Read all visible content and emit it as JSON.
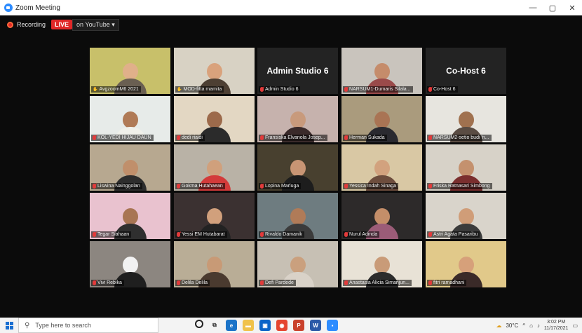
{
  "window": {
    "title": "Zoom Meeting",
    "minimize": "—",
    "maximize": "▢",
    "close": "✕"
  },
  "recording": {
    "label": "Recording",
    "live": "LIVE",
    "destination": "on YouTube ▾"
  },
  "tiles": [
    {
      "name": "AvgzoomM6 2021",
      "muted": false,
      "bg": "#c8c06a",
      "skin": "#e0b08a",
      "shirt": "#6a5f52"
    },
    {
      "name": "MOD-fitta mamita",
      "muted": false,
      "bg": "#d8d2c4",
      "skin": "#d9a27c",
      "shirt": "#4d3f33"
    },
    {
      "name": "Admin Studio 6",
      "muted": true,
      "title": "Admin Studio 6"
    },
    {
      "name": "NARSUM1-Dumaris Silala...",
      "muted": true,
      "bg": "#c9c4bd",
      "skin": "#c58c6b",
      "shirt": "#9a4a4a"
    },
    {
      "name": "Co-Host 6",
      "muted": true,
      "title": "Co-Host 6"
    },
    {
      "name": "KOL-YEDI HIJAU DAUN",
      "muted": true,
      "bg": "#e7ebe9",
      "skin": "#b07a56",
      "shirt": "#f0f0ea"
    },
    {
      "name": "dedi riaidi",
      "muted": true,
      "bg": "#e3d7c3",
      "skin": "#9c6a4b",
      "shirt": "#2b2b2b"
    },
    {
      "name": "Fransiska Elvanola Josep...",
      "muted": true,
      "bg": "#c6b2ad",
      "skin": "#c89a7c",
      "shirt": "#3a2a2a"
    },
    {
      "name": "Herman Sukada",
      "muted": true,
      "bg": "#aa9b7d",
      "skin": "#a97454",
      "shirt": "#2a2a30"
    },
    {
      "name": "NARSUM2-setio budi 'n...",
      "muted": true,
      "bg": "#e7e5df",
      "skin": "#a0714f",
      "shirt": "#5a4c43"
    },
    {
      "name": "Liswina Nainggolan",
      "muted": true,
      "bg": "#b7a890",
      "skin": "#c08f6b",
      "shirt": "#2d2d2d"
    },
    {
      "name": "Gokma Hutahaean",
      "muted": true,
      "bg": "#b9b2a6",
      "skin": "#d0a07c",
      "shirt": "#d33a3a"
    },
    {
      "name": "Lopina Marluga",
      "muted": true,
      "bg": "#48402f",
      "skin": "#c89574",
      "shirt": "#1d1d1d"
    },
    {
      "name": "Yessica Indah Sinaga",
      "muted": true,
      "bg": "#d9c8a4",
      "skin": "#d2a27e",
      "shirt": "#6d4d3d"
    },
    {
      "name": "Friska Ratnasari Simbong",
      "muted": true,
      "bg": "#d7d2c8",
      "skin": "#c4916e",
      "shirt": "#7a2e2e"
    },
    {
      "name": "Tegar Siahaan",
      "muted": true,
      "bg": "#e9c2cf",
      "skin": "#a87553",
      "shirt": "#2f2f2f"
    },
    {
      "name": "Yessi EM Hutabarat",
      "muted": true,
      "bg": "#3b3131",
      "skin": "#d1a07c",
      "shirt": "#222222"
    },
    {
      "name": "Rivaldo Damanik",
      "muted": true,
      "bg": "#6e7c80",
      "skin": "#b07b58",
      "shirt": "#3b3b3b"
    },
    {
      "name": "Nurul Adinda",
      "muted": true,
      "bg": "#2d2a2a",
      "skin": "#c48e69",
      "shirt": "#9b5c78"
    },
    {
      "name": "Astri Agata Pasaribu",
      "muted": true,
      "bg": "#d9d4cb",
      "skin": "#d09d78",
      "shirt": "#3b3b3b"
    },
    {
      "name": "Vivi Rebika",
      "muted": true,
      "bg": "#8c8680",
      "skin": "#f2f2f2",
      "shirt": "#1f1f1f"
    },
    {
      "name": "Delila Delila",
      "muted": true,
      "bg": "#b9ad96",
      "skin": "#c89a76",
      "shirt": "#4a3a2f"
    },
    {
      "name": "Defi Pardede",
      "muted": true,
      "bg": "#c7c0b4",
      "skin": "#caa07e",
      "shirt": "#d9d2c8"
    },
    {
      "name": "Anastasia Alicia Simanjun...",
      "muted": true,
      "bg": "#e8e2d6",
      "skin": "#c99b78",
      "shirt": "#2c2c2c"
    },
    {
      "name": "fitri ramadhani",
      "muted": true,
      "bg": "#e1c98a",
      "skin": "#d6a07a",
      "shirt": "#3a2a28"
    }
  ],
  "taskbar": {
    "search_placeholder": "Type here to search",
    "weather": "30°C",
    "time": "3:02 PM",
    "date": "11/17/2021"
  }
}
